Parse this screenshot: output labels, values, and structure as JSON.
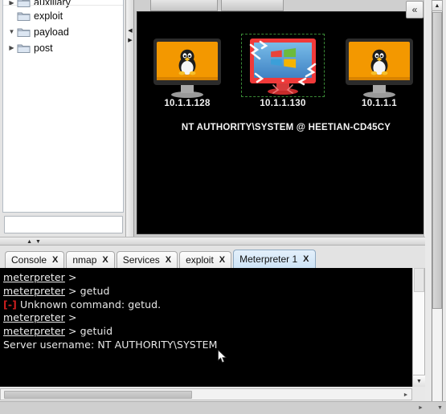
{
  "sidebar": {
    "tree_items": [
      {
        "label": "auxiliary",
        "twisty": "collapsed",
        "icon": "folder-icon"
      },
      {
        "label": "exploit",
        "twisty": "none",
        "icon": "folder-icon"
      },
      {
        "label": "payload",
        "twisty": "expanded",
        "icon": "folder-icon"
      },
      {
        "label": "post",
        "twisty": "collapsed",
        "icon": "folder-icon"
      }
    ],
    "search": {
      "value": "",
      "placeholder": ""
    }
  },
  "graph": {
    "top_tabs": [
      {
        "label": ""
      },
      {
        "label": ""
      }
    ],
    "collapse_icon": "«",
    "banner": "NT AUTHORITY\\SYSTEM @ HEETIAN-CD45CY",
    "hosts": [
      {
        "ip": "10.1.1.128",
        "os": "linux",
        "selected": false
      },
      {
        "ip": "10.1.1.130",
        "os": "windows",
        "selected": true
      },
      {
        "ip": "10.1.1.1",
        "os": "linux",
        "selected": false
      }
    ]
  },
  "tabs": [
    {
      "label": "Console",
      "close": "X",
      "active": false
    },
    {
      "label": "nmap",
      "close": "X",
      "active": false
    },
    {
      "label": "Services",
      "close": "X",
      "active": false
    },
    {
      "label": "exploit",
      "close": "X",
      "active": false
    },
    {
      "label": "Meterpreter 1",
      "close": "X",
      "active": true
    }
  ],
  "console": {
    "lines": [
      {
        "prompt": "meterpreter",
        "rest": " > "
      },
      {
        "prompt": "meterpreter",
        "rest": " > getud"
      },
      {
        "err": "[-]",
        "rest": " Unknown command: getud."
      },
      {
        "prompt": "meterpreter",
        "rest": " > "
      },
      {
        "prompt": "meterpreter",
        "rest": " > getuid"
      },
      {
        "plain": "Server username: NT AUTHORITY\\SYSTEM"
      }
    ]
  },
  "colors": {
    "console_bg": "#000000",
    "console_text": "#e8e8e8",
    "error_red": "#d01f1f",
    "selection_green": "#3a8a36",
    "active_tab_blue": "#cde3f6",
    "linux_screen": "#f39800",
    "windows_screen": "#e83a3a"
  },
  "icons": {
    "scroll_up": "▲",
    "scroll_down": "▼",
    "scroll_left": "◄",
    "scroll_right": "►",
    "twisty_collapsed": "▶",
    "twisty_expanded": "▼"
  }
}
